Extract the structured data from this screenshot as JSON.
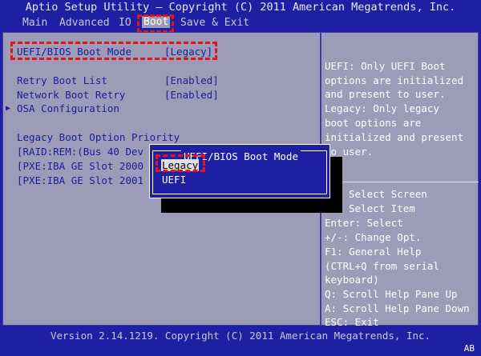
{
  "title": "Aptio Setup Utility – Copyright (C) 2011 American Megatrends, Inc.",
  "menu": [
    {
      "label": "Main",
      "active": false
    },
    {
      "label": "Advanced",
      "active": false
    },
    {
      "label": "IO",
      "active": false
    },
    {
      "label": "Boot",
      "active": true
    },
    {
      "label": "Save & Exit",
      "active": false
    }
  ],
  "settings": {
    "boot_mode": {
      "label": "UEFI/BIOS Boot Mode",
      "value": "[Legacy]"
    },
    "retry_boot": {
      "label": "Retry Boot List",
      "value": "[Enabled]"
    },
    "network_boot": {
      "label": "Network Boot Retry",
      "value": "[Enabled]"
    },
    "osa": {
      "label": "OSA Configuration"
    },
    "legacy_heading": "Legacy Boot Option Priority",
    "legacy_items": [
      "[RAID:REM:(Bus 40 Dev",
      "[PXE:IBA GE Slot 2000",
      "[PXE:IBA GE Slot 2001"
    ]
  },
  "help": {
    "lines": [
      "UEFI: Only UEFI Boot",
      "options are initialized",
      "and present to user.",
      "Legacy: Only legacy",
      "boot options are",
      "initialized and present",
      "to user."
    ],
    "keys": [
      "Select Screen",
      "Select Item",
      "Enter: Select",
      "+/-: Change Opt.",
      "F1: General Help",
      "(CTRL+Q from serial",
      "keyboard)",
      "Q: Scroll Help Pane Up",
      "A: Scroll Help Pane Down",
      "ESC: Exit"
    ]
  },
  "popup": {
    "title": "UEFI/BIOS Boot Mode",
    "options": [
      "Legacy",
      "UEFI"
    ],
    "selected": "Legacy"
  },
  "footer": "Version 2.14.1219. Copyright (C) 2011 American Megatrends, Inc.",
  "corner": "AB",
  "colors": {
    "background": "#1f1fa3",
    "panel": "#9c9cb8",
    "text_dark": "#1c1c9a",
    "highlight": "#e01818"
  }
}
